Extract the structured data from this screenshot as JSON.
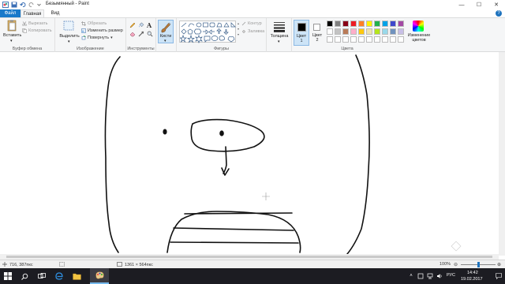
{
  "window": {
    "title": "Безымянный - Paint",
    "minimize_glyph": "—",
    "maximize_glyph": "☐",
    "close_glyph": "✕"
  },
  "tabs": {
    "file": "Файл",
    "home": "Главная",
    "view": "Вид",
    "help_glyph": "?"
  },
  "ribbon": {
    "clipboard": {
      "paste": "Вставить",
      "cut": "Вырезать",
      "copy": "Копировать",
      "label": "Буфер обмена"
    },
    "image": {
      "select": "Выделить",
      "crop": "Обрезать",
      "resize": "Изменить размер",
      "rotate": "Повернуть",
      "label": "Изображение"
    },
    "tools": {
      "label": "Инструменты",
      "text_tool": "A"
    },
    "brushes": {
      "label": "Кисти"
    },
    "shapes": {
      "outline": "Контур",
      "fill": "Заливка",
      "label": "Фигуры"
    },
    "size": {
      "label": "Толщина"
    },
    "colors": {
      "color1_label": "Цвет",
      "color1_num": "1",
      "color2_label": "Цвет",
      "color2_num": "2",
      "edit_label_1": "Изменение",
      "edit_label_2": "цветов",
      "label": "Цвета",
      "color1_value": "#000000",
      "color2_value": "#ffffff",
      "palette_row1": [
        "#000000",
        "#7f7f7f",
        "#880015",
        "#ed1c24",
        "#ff7f27",
        "#fff200",
        "#22b14c",
        "#00a2e8",
        "#3f48cc",
        "#a349a4"
      ],
      "palette_row2": [
        "#ffffff",
        "#c3c3c3",
        "#b97a57",
        "#ffaec9",
        "#ffc90e",
        "#efe4b0",
        "#b5e61d",
        "#99d9ea",
        "#7092be",
        "#c8bfe7"
      ]
    }
  },
  "status": {
    "cursor_pos": "716, 387пкс",
    "canvas_size": "1361 × 564пкс",
    "zoom": "100%",
    "zoom_level": 0.5
  },
  "taskbar": {
    "lang": "РУС",
    "time": "14:42",
    "date": "19.02.2017"
  }
}
